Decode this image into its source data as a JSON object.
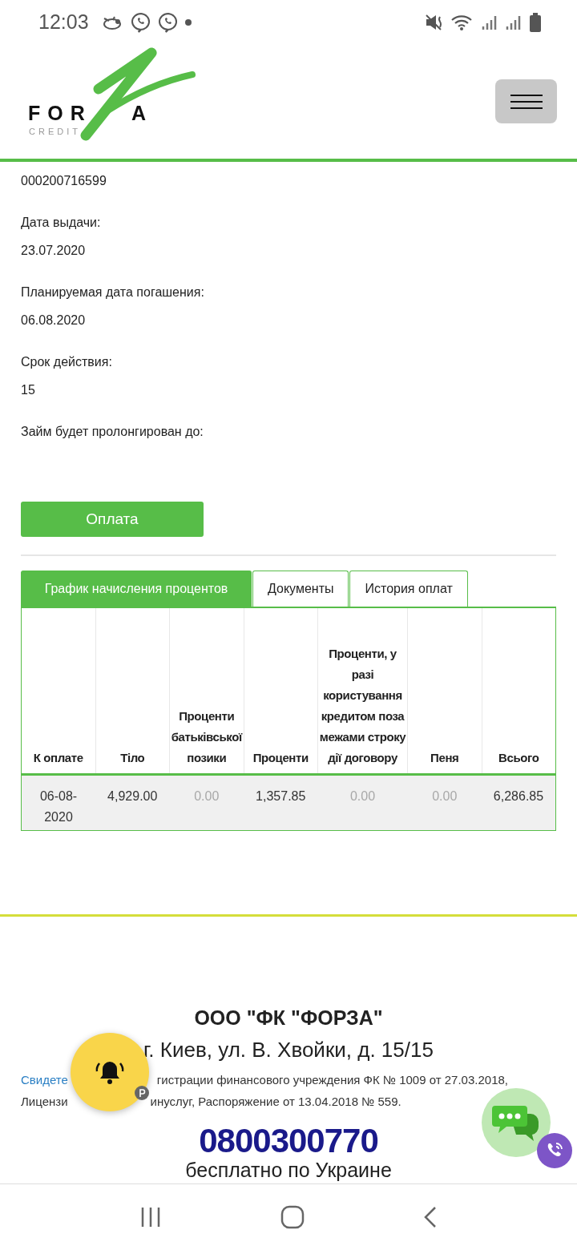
{
  "status_bar": {
    "time": "12:03"
  },
  "header": {
    "logo": {
      "word_left": "FOR",
      "word_right": "A",
      "tagline": "CREDIT"
    }
  },
  "loan": {
    "number": "000200716599",
    "fields": [
      {
        "label": "Дата выдачи:",
        "value": "23.07.2020"
      },
      {
        "label": "Планируемая дата погашения:",
        "value": "06.08.2020"
      },
      {
        "label": "Срок действия:",
        "value": "15"
      },
      {
        "label": "Займ будет пролонгирован до:"
      }
    ],
    "pay_button": "Оплата"
  },
  "tabs": [
    {
      "label": "График начисления процентов",
      "selected": true
    },
    {
      "label": "Документы",
      "selected": false
    },
    {
      "label": "История оплат",
      "selected": false
    }
  ],
  "table": {
    "columns": [
      "К оплате",
      "Тіло",
      "Проценти батьківської позики",
      "Проценти",
      "Проценти, у разі користування кредитом поза межами строку дії договору",
      "Пеня",
      "Всього"
    ],
    "rows": [
      {
        "cells": [
          {
            "text": "06-08-2020",
            "muted": false
          },
          {
            "text": "4,929.00",
            "muted": false
          },
          {
            "text": "0.00",
            "muted": true
          },
          {
            "text": "1,357.85",
            "muted": false
          },
          {
            "text": "0.00",
            "muted": true
          },
          {
            "text": "0.00",
            "muted": true
          },
          {
            "text": "6,286.85",
            "muted": false
          }
        ]
      }
    ]
  },
  "footer": {
    "company": "ООО \"ФК \"ФОРЗА\"",
    "address": "г. Киев, ул. В. Хвойки, д. 15/15",
    "license_link": "Свидете",
    "license_line_1": "гистрации финансового учреждения ФК № 1009 от 27.03.2018,",
    "license_line_2_start": "Лицензи",
    "license_line_2_end": "инуслуг, Распоряжение от 13.04.2018 № 559.",
    "phone": "0800300770",
    "phone_note": "бесплатно по Украине"
  }
}
